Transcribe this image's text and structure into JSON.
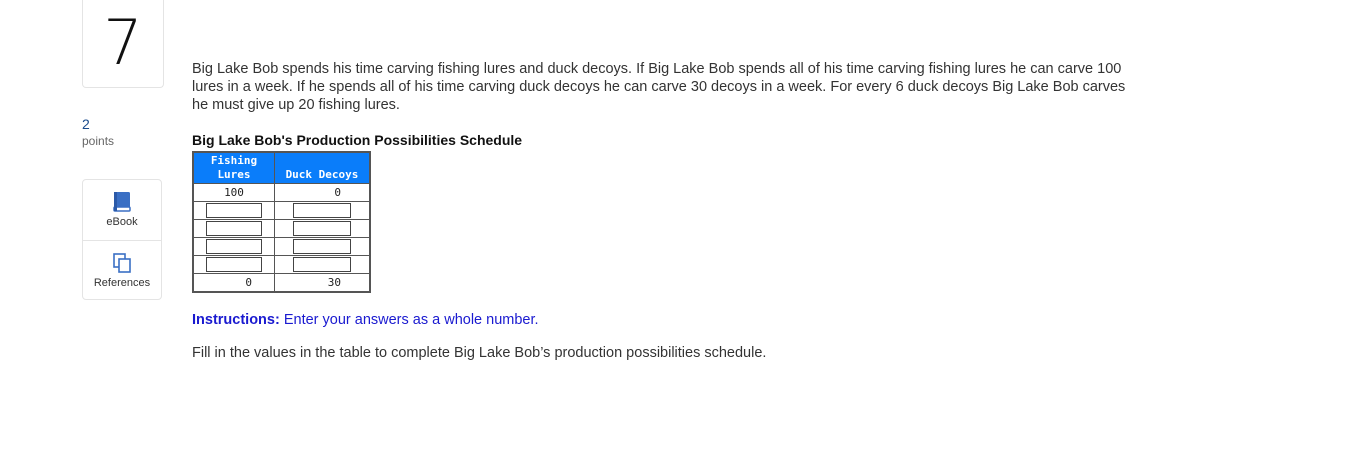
{
  "question": {
    "number": "7",
    "points": "2",
    "points_label": "points"
  },
  "tools": {
    "ebook_label": "eBook",
    "references_label": "References"
  },
  "question_text": "Big Lake Bob spends his time carving fishing lures and duck decoys. If Big Lake Bob spends all of his time carving fishing lures he can carve 100 lures in a week. If he spends all of his time carving duck decoys he can carve 30 decoys in a week. For every 6 duck decoys Big Lake Bob carves he must give up 20 fishing lures.",
  "schedule": {
    "title": "Big Lake Bob's Production Possibilities Schedule",
    "col1_line1": "Fishing",
    "col1_line2": "Lures",
    "col2": "Duck Decoys",
    "first_row": {
      "lures": "100",
      "decoys": "0"
    },
    "last_row": {
      "lures": "0",
      "decoys": "30"
    },
    "inputs": [
      {
        "lures": "",
        "decoys": ""
      },
      {
        "lures": "",
        "decoys": ""
      },
      {
        "lures": "",
        "decoys": ""
      },
      {
        "lures": "",
        "decoys": ""
      }
    ]
  },
  "instructions": {
    "label": "Instructions:",
    "text": "Enter your answers as a whole number."
  },
  "fill_text": "Fill in the values in the table to complete Big Lake Bob’s production possibilities schedule.",
  "colors": {
    "header_blue": "#0a7dfa",
    "instruction_blue": "#1a1ad0",
    "book_icon_blue": "#3a6fc4"
  },
  "icons": [
    "book-icon",
    "documents-icon"
  ]
}
